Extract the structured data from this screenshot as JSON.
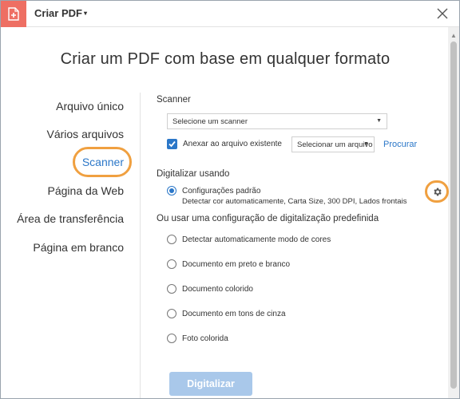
{
  "titlebar": {
    "app_menu_label": "Criar PDF",
    "caret": "▾"
  },
  "heading": "Criar um PDF com base em qualquer formato",
  "nav": {
    "items": [
      {
        "label": "Arquivo único"
      },
      {
        "label": "Vários arquivos"
      },
      {
        "label": "Scanner"
      },
      {
        "label": "Página da Web"
      },
      {
        "label": "Área de transferência"
      },
      {
        "label": "Página em branco"
      }
    ],
    "active_index": 2,
    "highlight_color": "#f0a040",
    "active_color": "#2b77c8"
  },
  "scanner": {
    "section_label": "Scanner",
    "scanner_select_value": "Selecione um scanner",
    "append_checkbox_label": "Anexar ao arquivo existente",
    "append_checked": true,
    "file_select_value": "Selecionar um arquivo",
    "browse_link": "Procurar"
  },
  "scan_using": {
    "section_label": "Digitalizar usando",
    "default_option_label": "Configurações padrão",
    "default_option_detail": "Detectar cor automaticamente, Carta Size, 300 DPI, Lados frontais",
    "settings_icon": "gear-icon"
  },
  "presets": {
    "section_label": "Ou usar uma configuração de digitalização predefinida",
    "options": [
      {
        "label": "Detectar automaticamente modo de cores"
      },
      {
        "label": "Documento em preto e branco"
      },
      {
        "label": "Documento colorido"
      },
      {
        "label": "Documento em tons de cinza"
      },
      {
        "label": "Foto colorida"
      }
    ]
  },
  "actions": {
    "scan_button": "Digitalizar",
    "button_color": "#a9c8ea"
  },
  "colors": {
    "accent": "#2b77c8",
    "app_icon_bg": "#ee6f63"
  }
}
